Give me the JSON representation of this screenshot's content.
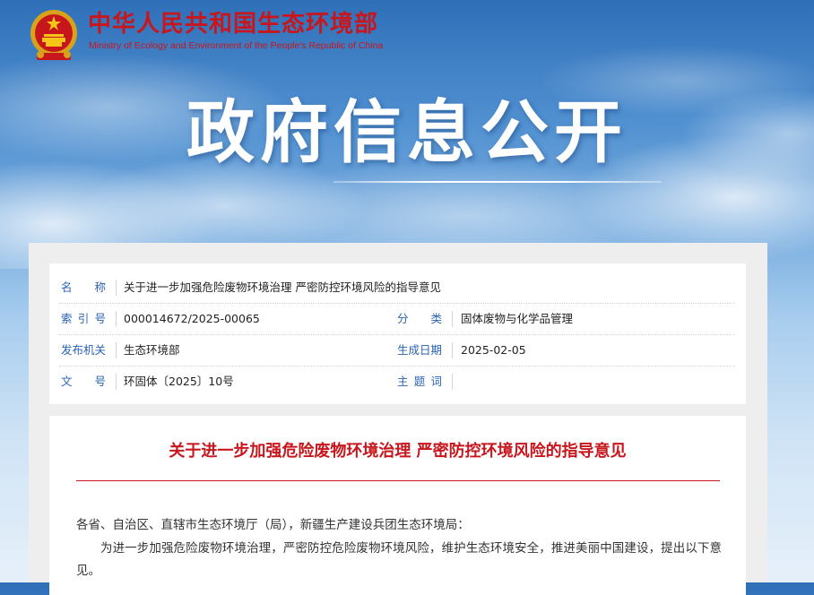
{
  "header": {
    "site_title_cn": "中华人民共和国生态环境部",
    "site_title_en": "Ministry of Ecology and Environment of the People's Republic of China",
    "emblem_icon": "national-emblem-icon"
  },
  "banner": {
    "title": "政府信息公开"
  },
  "metadata": {
    "rows": [
      {
        "left_label": "名称",
        "left_value": "关于进一步加强危险废物环境治理 严密防控环境风险的指导意见"
      },
      {
        "left_label": "索引号",
        "left_value": "000014672/2025-00065",
        "right_label": "分类",
        "right_value": "固体废物与化学品管理"
      },
      {
        "left_label": "发布机关",
        "left_value": "生态环境部",
        "right_label": "生成日期",
        "right_value": "2025-02-05"
      },
      {
        "left_label": "文号",
        "left_value": "环固体〔2025〕10号",
        "right_label": "主题词",
        "right_value": ""
      }
    ]
  },
  "article": {
    "title": "关于进一步加强危险废物环境治理 严密防控环境风险的指导意见",
    "salutation": "各省、自治区、直辖市生态环境厅（局），新疆生产建设兵团生态环境局：",
    "paragraph_1": "为进一步加强危险废物环境治理，严密防控危险废物环境风险，维护生态环境安全，推进美丽中国建设，提出以下意见。"
  },
  "colors": {
    "brand_red": "#c8161d",
    "label_blue": "#2a63b3",
    "sky_top": "#2f6fb8",
    "panel_bg": "#eeeeee"
  }
}
